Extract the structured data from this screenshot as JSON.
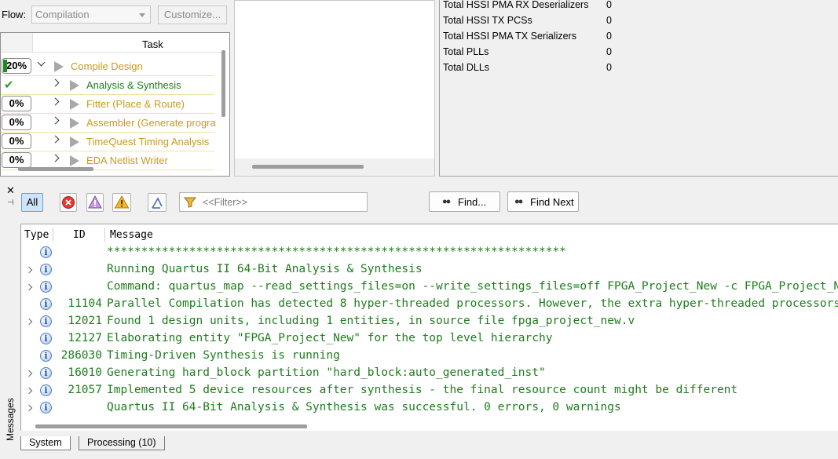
{
  "flow": {
    "label": "Flow:",
    "selected": "Compilation",
    "customize_label": "Customize..."
  },
  "tasks": {
    "header": "Task",
    "rows": [
      {
        "status": "20%",
        "label": "Compile Design",
        "expanded": true,
        "progress": 0.2
      },
      {
        "status": "check",
        "label": "Analysis & Synthesis"
      },
      {
        "status": "0%",
        "label": "Fitter (Place & Route)"
      },
      {
        "status": "0%",
        "label": "Assembler (Generate progra"
      },
      {
        "status": "0%",
        "label": "TimeQuest Timing Analysis"
      },
      {
        "status": "0%",
        "label": "EDA Netlist Writer"
      }
    ]
  },
  "summary": {
    "rows": [
      {
        "label": "Total HSSI PMA RX Deserializers",
        "value": "0"
      },
      {
        "label": "Total HSSI TX PCSs",
        "value": "0"
      },
      {
        "label": "Total HSSI PMA TX Serializers",
        "value": "0"
      },
      {
        "label": "Total PLLs",
        "value": "0"
      },
      {
        "label": "Total DLLs",
        "value": "0"
      }
    ]
  },
  "messages": {
    "side_title": "Messages",
    "close_glyph": "✕",
    "pin_glyph": "⊣",
    "toolbar": {
      "all_label": "All",
      "filter_placeholder": "<<Filter>>",
      "find_label": "Find...",
      "find_next_label": "Find Next"
    },
    "columns": {
      "type": "Type",
      "id": "ID",
      "message": "Message"
    },
    "rows": [
      {
        "expand": false,
        "id": "",
        "text": "*******************************************************************"
      },
      {
        "expand": true,
        "id": "",
        "text": "Running Quartus II 64-Bit Analysis & Synthesis"
      },
      {
        "expand": true,
        "id": "",
        "text": "Command: quartus_map --read_settings_files=on --write_settings_files=off FPGA_Project_New -c FPGA_Project_New"
      },
      {
        "expand": false,
        "id": "11104",
        "text": "Parallel Compilation has detected 8 hyper-threaded processors. However, the extra hyper-threaded processors"
      },
      {
        "expand": true,
        "id": "12021",
        "text": "Found 1 design units, including 1 entities, in source file fpga_project_new.v"
      },
      {
        "expand": false,
        "id": "12127",
        "text": "Elaborating entity \"FPGA_Project_New\" for the top level hierarchy"
      },
      {
        "expand": false,
        "id": "286030",
        "text": "Timing-Driven Synthesis is running"
      },
      {
        "expand": true,
        "id": "16010",
        "text": "Generating hard_block partition \"hard_block:auto_generated_inst\""
      },
      {
        "expand": true,
        "id": "21057",
        "text": "Implemented 5 device resources after synthesis - the final resource count might be different"
      },
      {
        "expand": true,
        "id": "",
        "text": "Quartus II 64-Bit Analysis & Synthesis was successful. 0 errors, 0 warnings"
      }
    ],
    "tabs": [
      {
        "label": "System",
        "active": true
      },
      {
        "label": "Processing (10)",
        "active": false
      }
    ]
  },
  "colors": {
    "task_label": "#c89a1f",
    "task_active": "#1e7d1e",
    "message_text": "#1e7d1e",
    "progress_fill": "#1f8b21",
    "all_button": "#cfe4f7"
  }
}
